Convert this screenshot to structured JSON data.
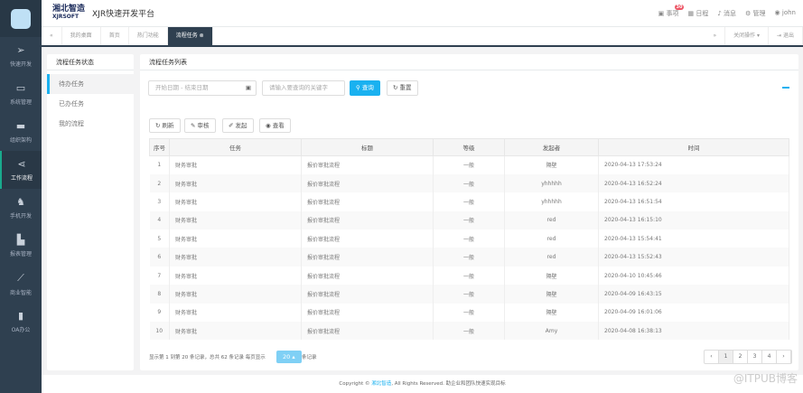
{
  "app": {
    "title": "XJR快速开发平台",
    "logo_text": "湘北智造",
    "logo_sub": "XJRSOFT"
  },
  "sidebar": {
    "items": [
      {
        "label": "快速开发",
        "icon": "paper-plane-icon"
      },
      {
        "label": "系统管理",
        "icon": "desktop-icon"
      },
      {
        "label": "组织架构",
        "icon": "hdd-icon"
      },
      {
        "label": "工作流程",
        "icon": "share-icon"
      },
      {
        "label": "手机开发",
        "icon": "android-icon"
      },
      {
        "label": "报表管理",
        "icon": "area-chart-icon"
      },
      {
        "label": "商业智能",
        "icon": "line-chart-icon"
      },
      {
        "label": "OA办公",
        "icon": "bookmark-icon"
      }
    ]
  },
  "header": {
    "todo": "事项",
    "todo_badge": "30",
    "schedule": "日程",
    "message": "消息",
    "manage": "管理",
    "user": "john"
  },
  "tabs": {
    "items": [
      "我的桌面",
      "首页",
      "热门功能",
      "流程任务"
    ],
    "close_ops": "关闭操作",
    "logout": "退出"
  },
  "left": {
    "title": "流程任务状态",
    "items": [
      "待办任务",
      "已办任务",
      "我的流程"
    ]
  },
  "main": {
    "title": "流程任务列表",
    "date_placeholder": "开始日期 - 结束日期",
    "keyword_placeholder": "请输入要查询的关键字",
    "search": "查询",
    "reset": "重置",
    "toolbar": {
      "refresh": "刷新",
      "audit": "审核",
      "initiate": "发起",
      "view": "查看"
    },
    "columns": [
      "序号",
      "任务",
      "标题",
      "等级",
      "发起者",
      "时间"
    ],
    "rows": [
      [
        "1",
        "财务审批",
        "报价审批流程",
        "一般",
        "隔壁",
        "2020-04-13 17:53:24"
      ],
      [
        "2",
        "财务审批",
        "报价审批流程",
        "一般",
        "yhhhhh",
        "2020-04-13 16:52:24"
      ],
      [
        "3",
        "财务审批",
        "报价审批流程",
        "一般",
        "yhhhhh",
        "2020-04-13 16:51:54"
      ],
      [
        "4",
        "财务审批",
        "报价审批流程",
        "一般",
        "red",
        "2020-04-13 16:15:10"
      ],
      [
        "5",
        "财务审批",
        "报价审批流程",
        "一般",
        "red",
        "2020-04-13 15:54:41"
      ],
      [
        "6",
        "财务审批",
        "报价审批流程",
        "一般",
        "red",
        "2020-04-13 15:52:43"
      ],
      [
        "7",
        "财务审批",
        "报价审批流程",
        "一般",
        "隔壁",
        "2020-04-10 10:45:46"
      ],
      [
        "8",
        "财务审批",
        "报价审批流程",
        "一般",
        "隔壁",
        "2020-04-09 16:43:15"
      ],
      [
        "9",
        "财务审批",
        "报价审批流程",
        "一般",
        "隔壁",
        "2020-04-09 16:01:06"
      ],
      [
        "10",
        "财务审批",
        "报价审批流程",
        "一般",
        "Amy",
        "2020-04-08 16:38:13"
      ]
    ],
    "pager": {
      "info": "显示第 1 到第 20 条记录，总共 62 条记录 每页显示",
      "page_size": "20",
      "suffix": "条记录",
      "pages": [
        "‹",
        "1",
        "2",
        "3",
        "4",
        "›"
      ],
      "current": "1"
    }
  },
  "footer": {
    "prefix": "Copyright © ",
    "link": "湘北智造",
    "suffix": ", All Rights Reserved. 助企业和团队快速实现目标"
  },
  "watermark": "@ITPUB博客"
}
